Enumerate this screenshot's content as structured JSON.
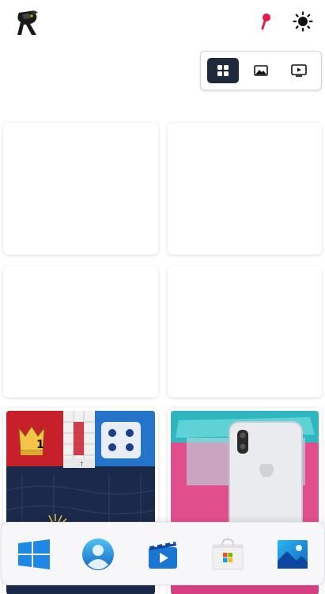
{
  "header": {
    "logo_icon": "raven-logo-icon",
    "pin_icon": "location-pin-icon",
    "theme_icon": "sun-icon"
  },
  "view_toggle": {
    "options": [
      {
        "icon": "grid-icon",
        "active": true
      },
      {
        "icon": "image-icon",
        "active": false
      },
      {
        "icon": "slideshow-icon",
        "active": false
      }
    ]
  },
  "gallery": {
    "cards": [
      {
        "state": "empty"
      },
      {
        "state": "empty"
      },
      {
        "state": "empty"
      },
      {
        "state": "empty"
      },
      {
        "state": "image",
        "subject": "ludo-game-screenshot",
        "badge_number": "1"
      },
      {
        "state": "image",
        "subject": "white-iphone-photo"
      }
    ]
  },
  "taskbar": {
    "items": [
      {
        "icon": "windows-start-icon"
      },
      {
        "icon": "user-account-icon"
      },
      {
        "icon": "video-player-icon"
      },
      {
        "icon": "microsoft-store-icon"
      },
      {
        "icon": "photos-icon"
      }
    ]
  },
  "colors": {
    "toggle_active": "#1e293b",
    "pin": "#e11d48",
    "windows_blue": "#1e88e5"
  }
}
